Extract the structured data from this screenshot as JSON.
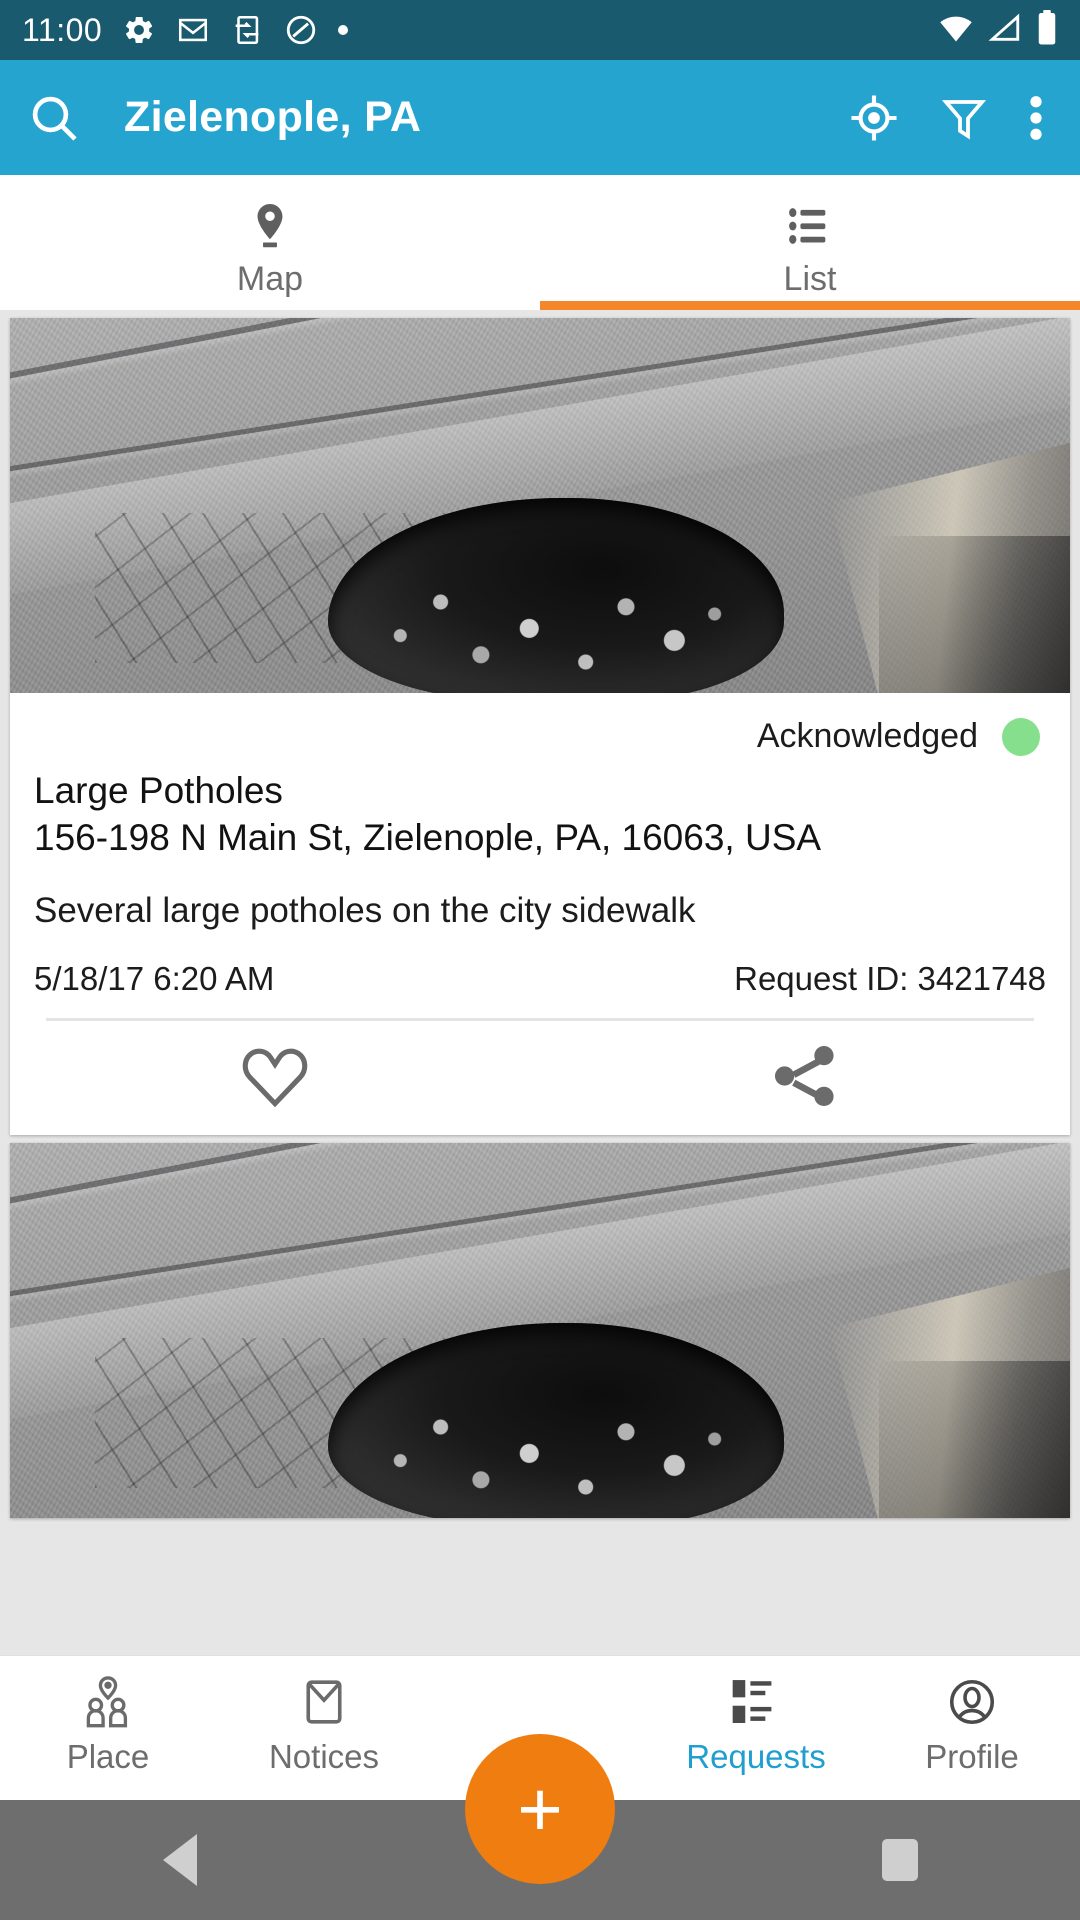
{
  "status_bar": {
    "time": "11:00",
    "left_icons": [
      "settings-gear-icon",
      "gmail-icon",
      "sync-device-icon",
      "do-not-disturb-icon",
      "dot-icon"
    ],
    "right_icons": [
      "wifi-icon",
      "cell-signal-icon",
      "battery-icon"
    ],
    "background_color": "#1a5a6e"
  },
  "app_bar": {
    "title": "Zielenople, PA",
    "search_icon": "search-icon",
    "locate_icon": "crosshair-location-icon",
    "filter_icon": "filter-funnel-icon",
    "overflow_icon": "overflow-menu-icon",
    "background_color": "#25a4d0"
  },
  "tabs": {
    "items": [
      {
        "label": "Map",
        "icon": "map-pin-icon",
        "active": false
      },
      {
        "label": "List",
        "icon": "list-icon",
        "active": true
      }
    ],
    "indicator_color": "#f3872a"
  },
  "requests": [
    {
      "photo_alt": "pothole-photo",
      "status": "Acknowledged",
      "status_color": "#86df8d",
      "title": "Large Potholes",
      "address": "156-198 N Main St, Zielenople, PA, 16063, USA",
      "description": "Several large potholes on the city sidewalk",
      "date": "5/18/17 6:20 AM",
      "request_id": "Request ID: 3421748",
      "favorite_icon": "heart-icon",
      "share_icon": "share-icon"
    },
    {
      "photo_alt": "pothole-photo"
    }
  ],
  "bottom_nav": {
    "items": [
      {
        "label": "Place",
        "icon": "people-place-icon",
        "active": false
      },
      {
        "label": "Notices",
        "icon": "envelope-icon",
        "active": false
      },
      {
        "label": "Requests",
        "icon": "requests-list-icon",
        "active": true
      },
      {
        "label": "Profile",
        "icon": "person-profile-icon",
        "active": false
      }
    ],
    "fab": {
      "icon": "plus-icon",
      "color": "#ef7d10"
    },
    "active_color": "#1f9fd0"
  },
  "android_nav": {
    "back": "back-triangle-icon",
    "home": "home-circle-icon",
    "recents": "recents-square-icon"
  }
}
